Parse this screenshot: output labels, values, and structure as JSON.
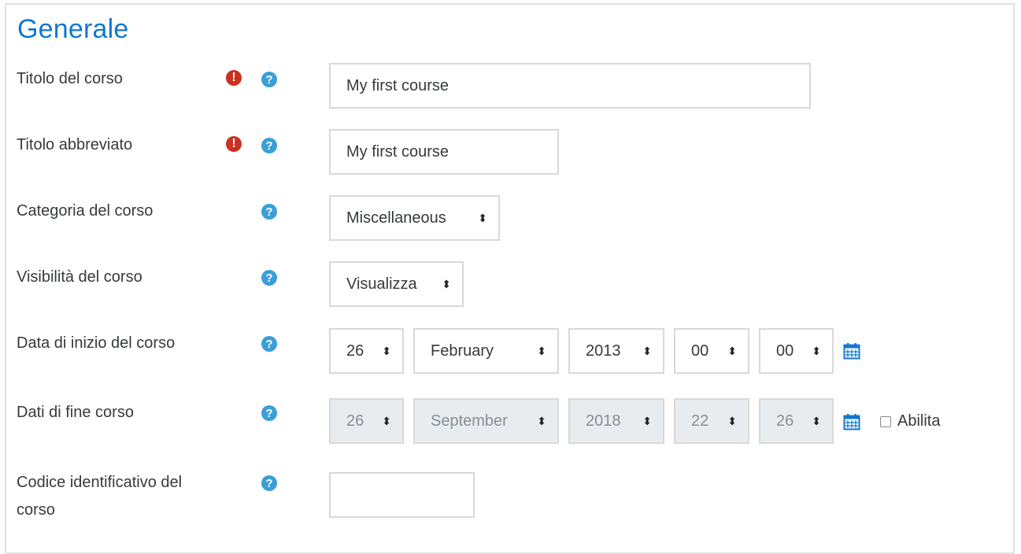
{
  "section": {
    "title": "Generale"
  },
  "fields": {
    "fullname": {
      "label": "Titolo del corso",
      "value": "My first course"
    },
    "shortname": {
      "label": "Titolo abbreviato",
      "value": "My first course"
    },
    "category": {
      "label": "Categoria del corso",
      "value": "Miscellaneous"
    },
    "visibility": {
      "label": "Visibilità del corso",
      "value": "Visualizza"
    },
    "startdate": {
      "label": "Data di inizio del corso",
      "day": "26",
      "month": "February",
      "year": "2013",
      "hour": "00",
      "minute": "00"
    },
    "enddate": {
      "label": "Dati di fine corso",
      "day": "26",
      "month": "September",
      "year": "2018",
      "hour": "22",
      "minute": "26",
      "enable_label": "Abilita",
      "enabled": false
    },
    "idnumber": {
      "label_line1": "Codice identificativo del",
      "label_line2": "corso",
      "value": ""
    }
  },
  "icons": {
    "required": "exclamation-circle-icon",
    "help": "question-circle-icon",
    "calendar": "calendar-icon",
    "select_arrows": "sort-arrows-icon"
  },
  "colors": {
    "heading": "#1177d1",
    "required": "#ca3120",
    "help": "#3a9fd7",
    "calendar": "#1177d1",
    "disabled_bg": "#e9ecef"
  }
}
